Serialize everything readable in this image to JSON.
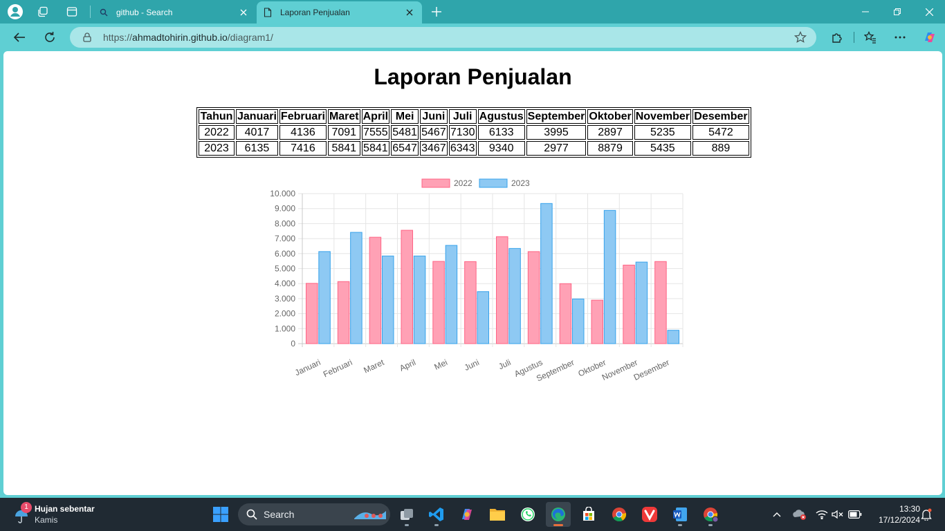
{
  "browser": {
    "tabs": [
      {
        "title": "github - Search",
        "active": false
      },
      {
        "title": "Laporan Penjualan",
        "active": true
      }
    ],
    "url_prefix": "https://",
    "url_host": "ahmadtohirin.github.io",
    "url_path": "/diagram1/"
  },
  "page": {
    "title": "Laporan Penjualan",
    "table": {
      "headers": [
        "Tahun",
        "Januari",
        "Februari",
        "Maret",
        "April",
        "Mei",
        "Juni",
        "Juli",
        "Agustus",
        "September",
        "Oktober",
        "November",
        "Desember"
      ],
      "rows": [
        [
          "2022",
          "4017",
          "4136",
          "7091",
          "7555",
          "5481",
          "5467",
          "7130",
          "6133",
          "3995",
          "2897",
          "5235",
          "5472"
        ],
        [
          "2023",
          "6135",
          "7416",
          "5841",
          "5841",
          "6547",
          "3467",
          "6343",
          "9340",
          "2977",
          "8879",
          "5435",
          "889"
        ]
      ]
    }
  },
  "chart_data": {
    "type": "bar",
    "title": "",
    "categories": [
      "Januari",
      "Februari",
      "Maret",
      "April",
      "Mei",
      "Juni",
      "Juli",
      "Agustus",
      "September",
      "Oktober",
      "November",
      "Desember"
    ],
    "series": [
      {
        "name": "2022",
        "values": [
          4017,
          4136,
          7091,
          7555,
          5481,
          5467,
          7130,
          6133,
          3995,
          2897,
          5235,
          5472
        ],
        "fill": "#ffa1b5",
        "stroke": "#ff6384"
      },
      {
        "name": "2023",
        "values": [
          6135,
          7416,
          5841,
          5841,
          6547,
          3467,
          6343,
          9340,
          2977,
          8879,
          5435,
          889
        ],
        "fill": "#8ec9f3",
        "stroke": "#36a2eb"
      }
    ],
    "ylim": [
      0,
      10000
    ],
    "yticks": [
      "0",
      "1.000",
      "2.000",
      "3.000",
      "4.000",
      "5.000",
      "6.000",
      "7.000",
      "8.000",
      "9.000",
      "10.000"
    ],
    "legend": "top",
    "grid": true
  },
  "taskbar": {
    "weather_title": "Hujan sebentar",
    "weather_sub": "Kamis",
    "weather_badge": "1",
    "search_label": "Search",
    "apps": [
      "task-view",
      "vscode",
      "copilot",
      "file-explorer",
      "whatsapp",
      "edge",
      "store",
      "chrome",
      "vivaldi",
      "word",
      "chrome-profile"
    ],
    "time": "13:30",
    "date": "17/12/2024"
  }
}
